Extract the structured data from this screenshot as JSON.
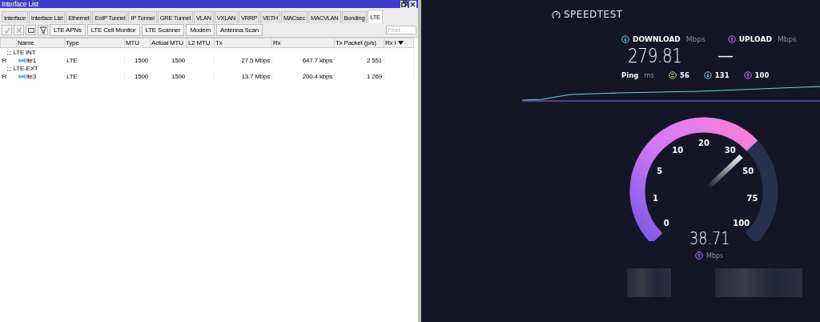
{
  "window": {
    "title": "Interface List"
  },
  "tabs": [
    {
      "label": "Interface",
      "selected": false
    },
    {
      "label": "Interface List",
      "selected": false
    },
    {
      "label": "Ethernet",
      "selected": false
    },
    {
      "label": "EoIP Tunnel",
      "selected": false
    },
    {
      "label": "IP Tunnel",
      "selected": false
    },
    {
      "label": "GRE Tunnel",
      "selected": false
    },
    {
      "label": "VLAN",
      "selected": false
    },
    {
      "label": "VXLAN",
      "selected": false
    },
    {
      "label": "VRRP",
      "selected": false
    },
    {
      "label": "VETH",
      "selected": false
    },
    {
      "label": "MACsec",
      "selected": false
    },
    {
      "label": "MACVLAN",
      "selected": false
    },
    {
      "label": "Bonding",
      "selected": false
    },
    {
      "label": "LTE",
      "selected": true
    }
  ],
  "toolbar": {
    "buttons": [
      "LTE APNs",
      "LTE Cell Monitor",
      "LTE Scanner",
      "Modem",
      "Antenna Scan"
    ],
    "search": {
      "placeholder": "Find"
    }
  },
  "table": {
    "columns": [
      "Name",
      "Type",
      "MTU",
      "Actual MTU",
      "L2 MTU",
      "Tx",
      "Rx",
      "Tx Packet (p/s)",
      "Rx I"
    ],
    "groups": [
      {
        "comment": ";;; LTE INT",
        "rows": [
          {
            "flag": "R",
            "name": "lte1",
            "type": "LTE",
            "mtu": "1500",
            "actual_mtu": "1500",
            "tx": "27.5 Mbps",
            "rx": "647.7 kbps",
            "tx_packet": "2 551"
          }
        ]
      },
      {
        "comment": ";;; LTE-EXT",
        "rows": [
          {
            "flag": "R",
            "name": "lte3",
            "type": "LTE",
            "mtu": "1500",
            "actual_mtu": "1500",
            "tx": "13.7 Mbps",
            "rx": "200.4 kbps",
            "tx_packet": "1 269"
          }
        ]
      }
    ]
  },
  "speedtest": {
    "brand": "SPEEDTEST",
    "download": {
      "label": "DOWNLOAD",
      "unit": "Mbps",
      "value": "279.81"
    },
    "upload": {
      "label": "UPLOAD",
      "unit": "Mbps",
      "value": "—"
    },
    "ping": {
      "label": "Ping",
      "unit": "ms",
      "idle": "56",
      "download": "131",
      "upload": "100"
    },
    "gauge": {
      "ticks": [
        "0",
        "1",
        "5",
        "10",
        "20",
        "30",
        "50",
        "75",
        "100"
      ],
      "reading": "38.71",
      "unit": "Mbps"
    }
  }
}
